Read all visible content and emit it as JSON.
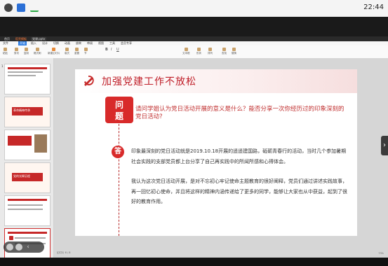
{
  "system": {
    "time": "22:44"
  },
  "app": {
    "tabs": [
      "首页",
      "稻壳模板",
      "党课.pptx"
    ],
    "menus": [
      "文件",
      "开始",
      "插入",
      "设计",
      "切换",
      "动画",
      "放映",
      "审阅",
      "视图",
      "工具",
      "会员专享"
    ],
    "ribbon": [
      "粘贴",
      "剪切",
      "复制",
      "格式刷",
      "新建幻灯片",
      "版式",
      "重置",
      "节",
      "B",
      "I",
      "U",
      "文本框",
      "形状",
      "排列",
      "查找",
      "替换"
    ]
  },
  "thumbnails": [
    {
      "num": "1",
      "caption": ""
    },
    {
      "num": "",
      "caption": "革命精神传承"
    },
    {
      "num": "",
      "caption": ""
    },
    {
      "num": "",
      "caption": "党的光辉历程"
    },
    {
      "num": "",
      "caption": ""
    },
    {
      "num": "",
      "caption": ""
    }
  ],
  "slide": {
    "title": "加强党建工作不放松",
    "question_badge": [
      "问",
      "题"
    ],
    "answer_badge": "答",
    "question": "请问学姐认为党日活动开展的意义是什么？能否分享一次你经历过的印象深刻的党日活动?",
    "answer_p1": "印象最深刻的党日活动就是2019.10.18开展的遥遥建国路，砥砺青春行的活动，当时几个参加暑期社会实践的支部党员都上台分享了自己再实践中的所闻所感和心得体会。",
    "answer_p2": "我认为这次党日活动开展，是对不忘初心牢记使命主题教育的很好阐释，党员们通过讲述实践故事，再一回忆初心使命，并且将这样的精神内涵传递给了更多的同学，能够让大家也从中获益，起到了很好的教育作用。"
  },
  "status": {
    "left": "幻灯片 6 / 8",
    "right": "73%"
  },
  "colors": {
    "accent": "#d82a2a",
    "title": "#c0202a"
  }
}
